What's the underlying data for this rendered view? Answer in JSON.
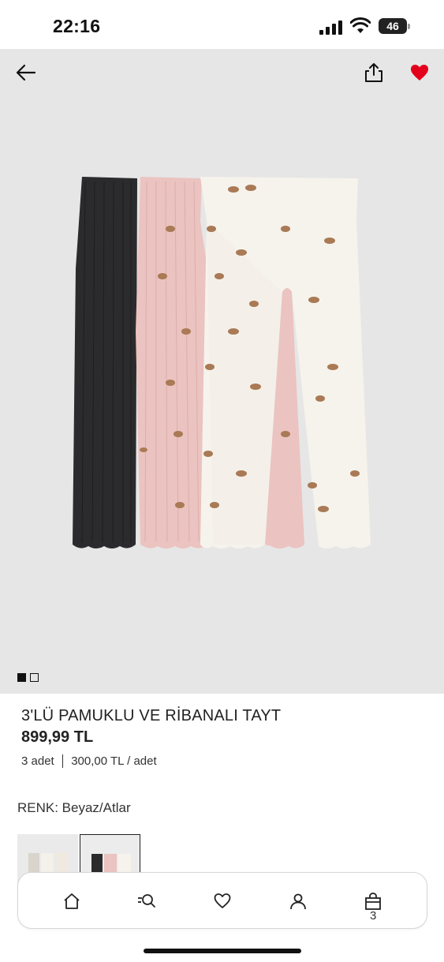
{
  "status_bar": {
    "time": "22:16",
    "battery": "46"
  },
  "header": {
    "back_icon": "arrow-left-icon",
    "share_icon": "share-icon",
    "favorite_icon": "heart-icon",
    "favorite_color": "#e3001b"
  },
  "gallery": {
    "image_count": 2,
    "active_index": 0
  },
  "product": {
    "title": "3'LÜ PAMUKLU VE RİBANALI TAYT",
    "price": "899,99 TL",
    "quantity": "3 adet",
    "unit_price": "300,00 TL / adet",
    "color_label": "RENK: Beyaz/Atlar"
  },
  "nav": {
    "items": [
      {
        "name": "home",
        "icon": "home-icon"
      },
      {
        "name": "search",
        "icon": "search-icon"
      },
      {
        "name": "favorites",
        "icon": "heart-outline-icon"
      },
      {
        "name": "account",
        "icon": "user-icon"
      },
      {
        "name": "cart",
        "icon": "shopping-bag-icon"
      }
    ],
    "cart_count": "3"
  },
  "colors": {
    "image_bg": "#e6e6e6",
    "legging_black": "#2b2b2d",
    "legging_pink": "#ebc3c0",
    "legging_white": "#f6f3ec"
  }
}
